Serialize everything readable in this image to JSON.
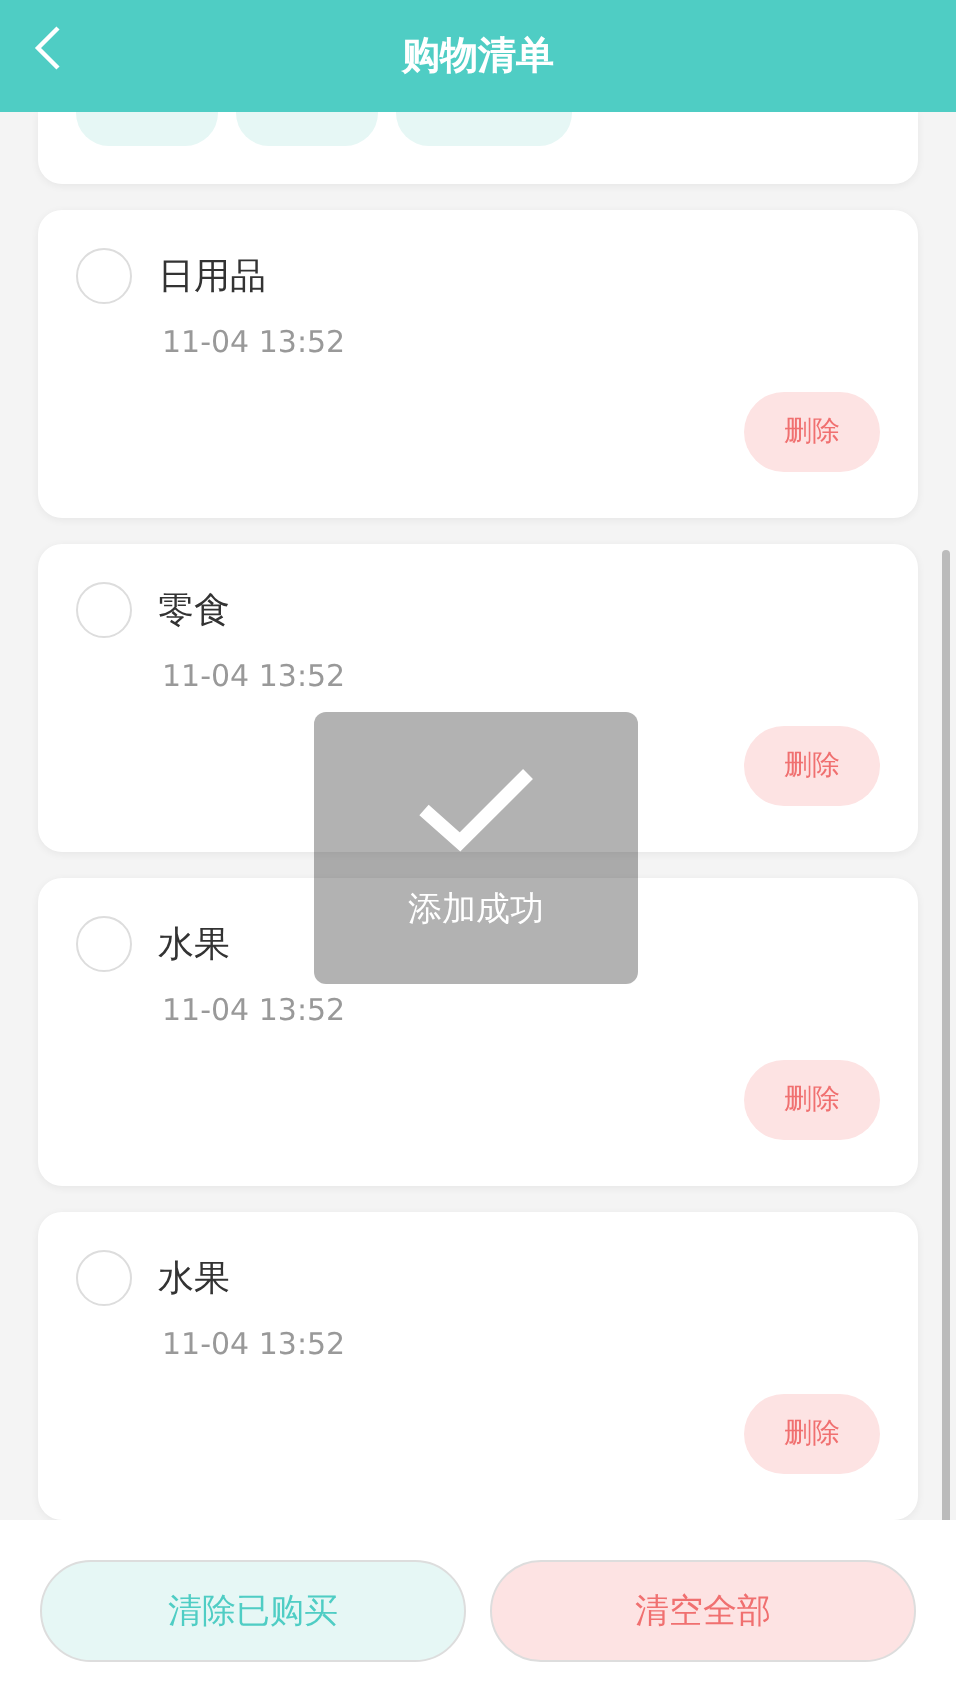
{
  "header": {
    "title": "购物清单"
  },
  "items": [
    {
      "title": "日用品",
      "time": "11-04 13:52",
      "checked": false,
      "delete_label": "删除"
    },
    {
      "title": "零食",
      "time": "11-04 13:52",
      "checked": false,
      "delete_label": "删除"
    },
    {
      "title": "水果",
      "time": "11-04 13:52",
      "checked": false,
      "delete_label": "删除"
    },
    {
      "title": "水果",
      "time": "11-04 13:52",
      "checked": false,
      "delete_label": "删除"
    }
  ],
  "toast": {
    "text": "添加成功"
  },
  "footer": {
    "clear_bought": "清除已购买",
    "clear_all": "清空全部"
  }
}
